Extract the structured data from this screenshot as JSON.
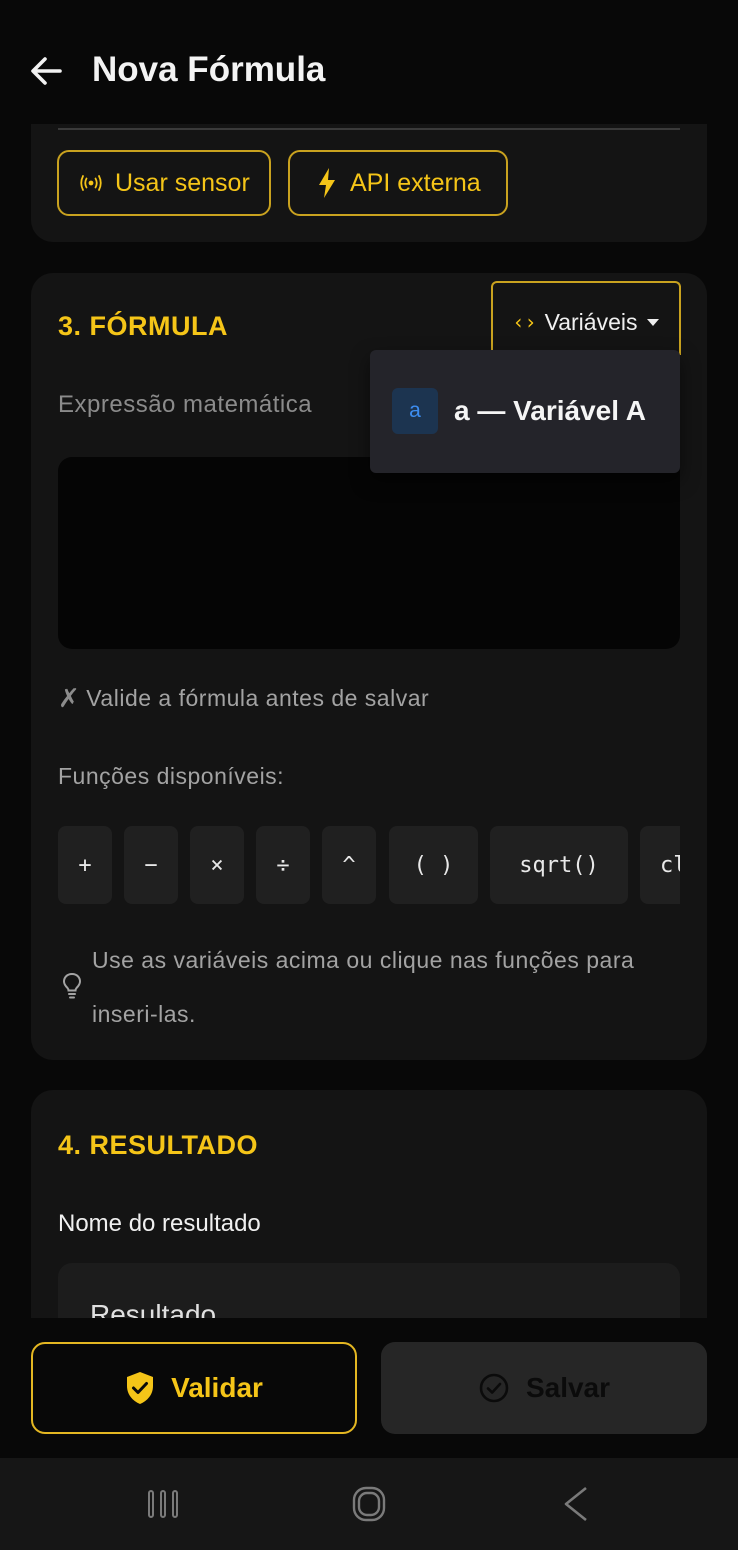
{
  "header": {
    "title": "Nova Fórmula",
    "back_icon": "arrow-left-icon"
  },
  "source_card": {
    "buttons": [
      {
        "label": "Usar sensor",
        "icon": "sensor-broadcast-icon"
      },
      {
        "label": "API externa",
        "icon": "lightning-bolt-icon"
      }
    ]
  },
  "formula": {
    "title": "3. FÓRMULA",
    "variables_button": "Variáveis",
    "expression_label": "Expressão matemática",
    "expression_value": "",
    "validation_message": "Valide a fórmula antes de salvar",
    "validation_icon": "✗",
    "functions_label": "Funções disponíveis:",
    "functions": [
      "+",
      "−",
      "×",
      "÷",
      "^",
      "( )",
      "sqrt()",
      "cl"
    ],
    "hint": "Use as variáveis acima ou clique nas funções para inseri-las."
  },
  "variables_dropdown": {
    "items": [
      {
        "badge": "a",
        "label": "a — Variável A"
      }
    ]
  },
  "result": {
    "title": "4. RESULTADO",
    "name_label": "Nome do resultado",
    "name_value": "Resultado"
  },
  "actions": {
    "validate_label": "Validar",
    "save_label": "Salvar"
  },
  "colors": {
    "accent": "#f5c518",
    "background": "#080808",
    "card": "#141414",
    "badge_blue": "#3d8df0"
  }
}
